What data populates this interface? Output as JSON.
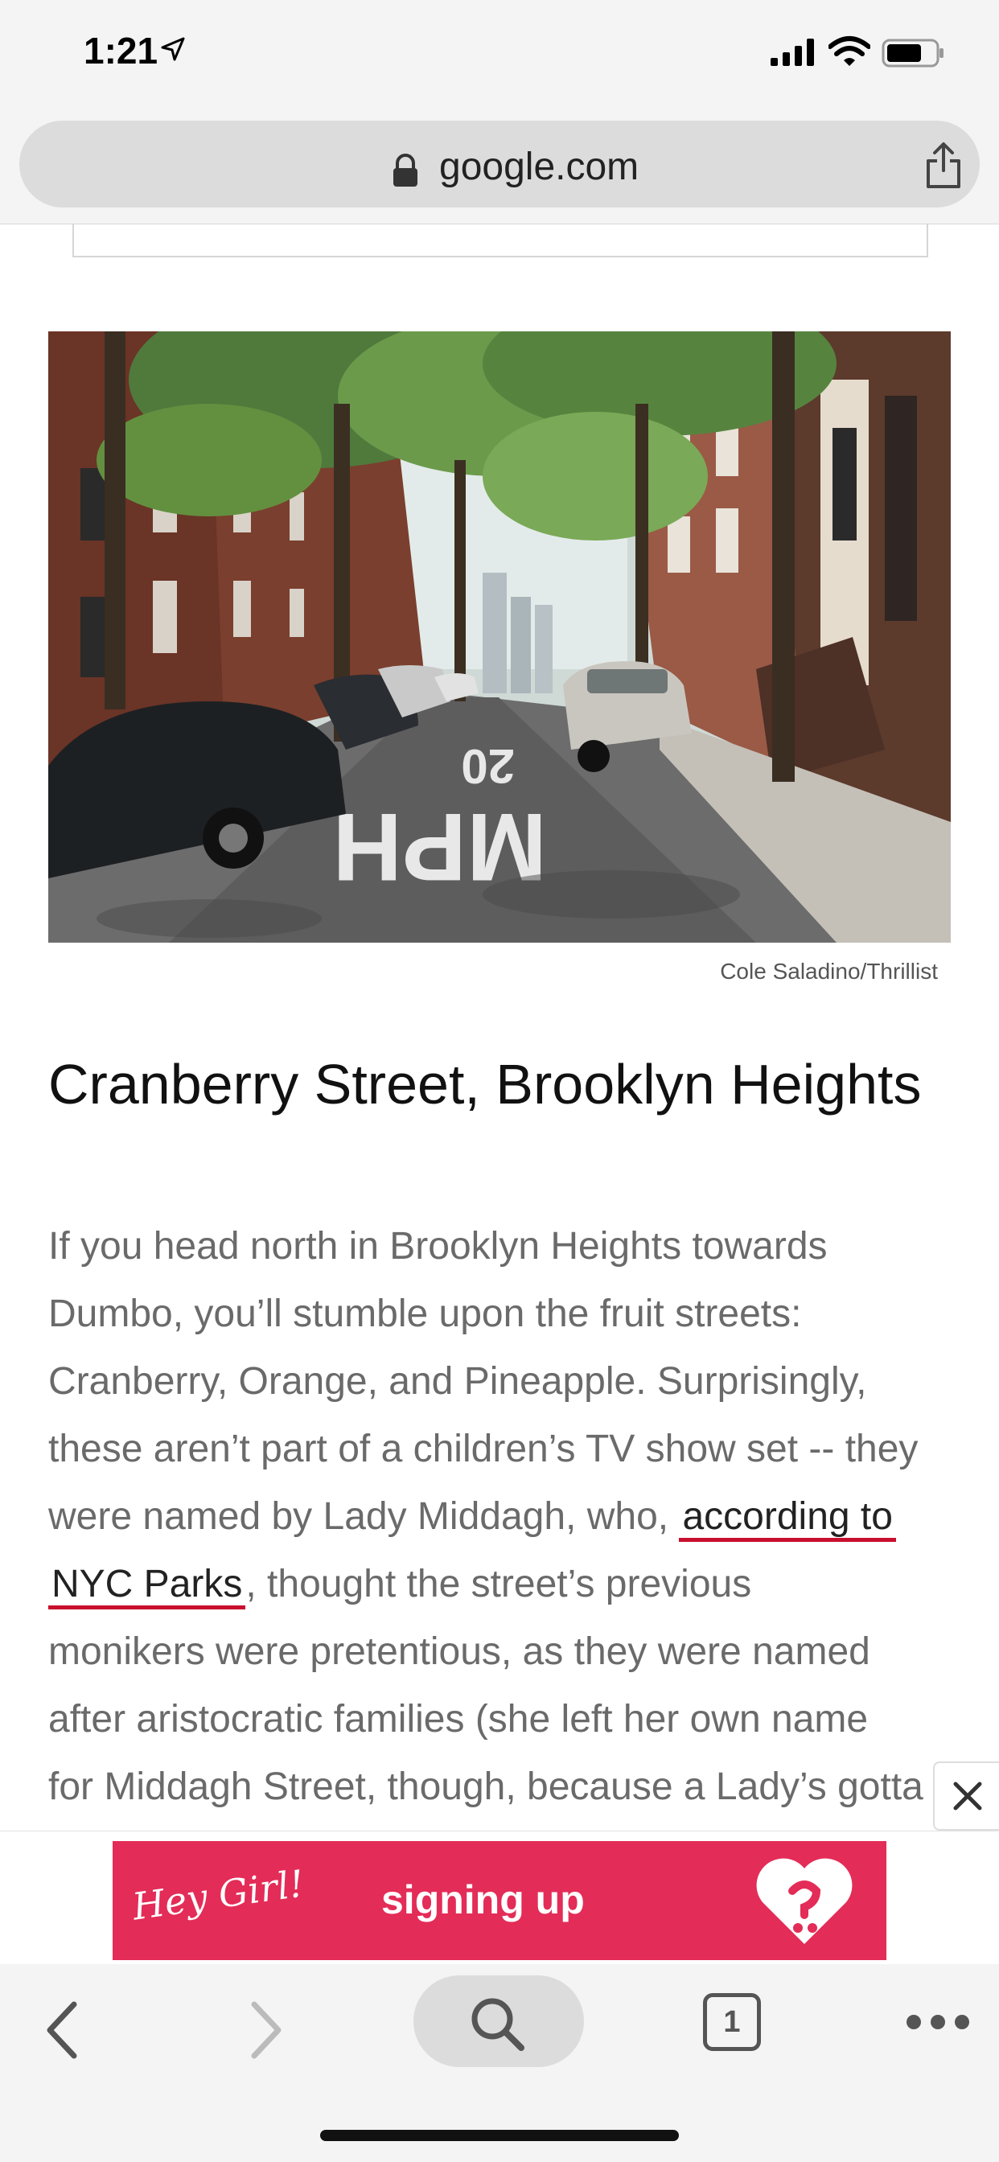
{
  "status_bar": {
    "time": "1:21",
    "location_icon": "location-arrow-icon",
    "signal_icon": "cellular-signal-icon",
    "wifi_icon": "wifi-icon",
    "battery_icon": "battery-icon"
  },
  "browser": {
    "url": "google.com",
    "lock_icon": "lock-icon",
    "share_icon": "share-icon"
  },
  "article": {
    "image_alt": "Tree-lined Cranberry Street with parked cars and 20 MPH road marking",
    "caption": "Cole Saladino/Thrillist",
    "heading": "Cranberry Street, Brooklyn Heights",
    "lines": {
      "l1": "If you head north in Brooklyn Heights towards",
      "l2": "Dumbo, you’ll stumble upon the fruit streets:",
      "l3": "Cranberry, Orange, and Pineapple. Surprisingly,",
      "l4": "these aren’t part of a children’s TV show set -- they",
      "l5_before": "were named by Lady Middagh, who,",
      "link_part1": "according to",
      "link_part2": "NYC Parks",
      "l6_after": ", thought the street’s previous",
      "l7": "monikers were pretentious, as they were named",
      "l8": "after aristocratic families (she left her own name",
      "l9": "for Middagh Street, though, because a Lady’s gotta"
    }
  },
  "ad": {
    "hey_text": "Hey Girl!",
    "cta_text": "signing up",
    "close_icon": "close-icon",
    "brand_color": "#e32c57"
  },
  "toolbar": {
    "tab_count": "1",
    "back_icon": "chevron-left-icon",
    "forward_icon": "chevron-right-icon",
    "search_icon": "search-icon",
    "more_icon": "more-dots-icon"
  }
}
